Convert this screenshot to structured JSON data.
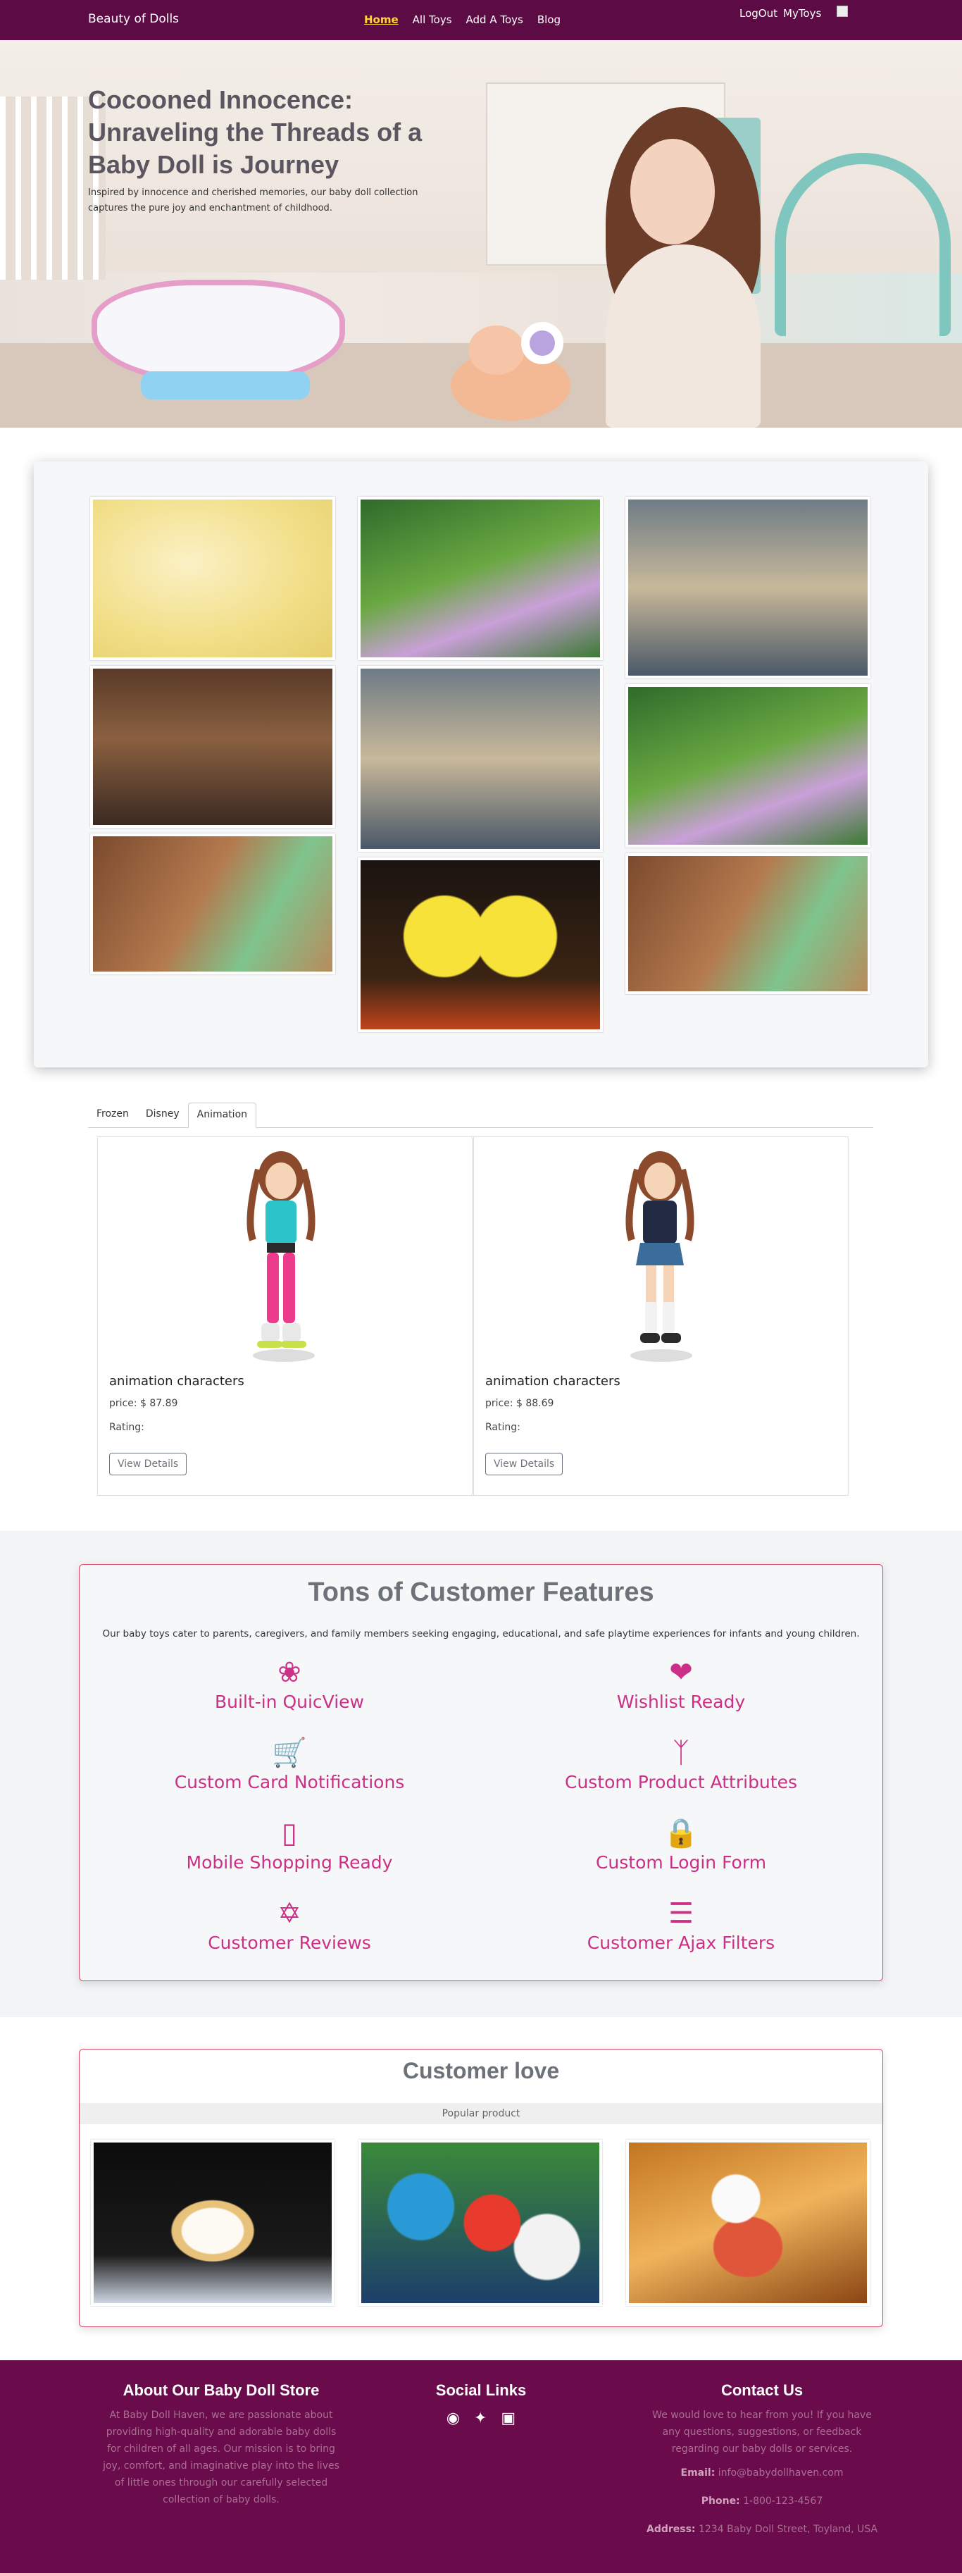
{
  "nav": {
    "brand": "Beauty of Dolls",
    "links": [
      "Home",
      "All Toys",
      "Add A Toys",
      "Blog"
    ],
    "logout": "LogOut",
    "mytoys": "MyToys"
  },
  "hero": {
    "title": "Cocooned Innocence: Unraveling the Threads of a Baby Doll is Journey",
    "subtitle": "Inspired by innocence and cherished memories, our baby doll collection captures the pure joy and enchantment of childhood."
  },
  "tabs": [
    "Frozen",
    "Disney",
    "Animation"
  ],
  "active_tab": "Animation",
  "products": [
    {
      "title": "animation characters",
      "price": "price: $ 87.89",
      "rating": "Rating:",
      "button": "View Details"
    },
    {
      "title": "animation characters",
      "price": "price: $ 88.69",
      "rating": "Rating:",
      "button": "View Details"
    }
  ],
  "features": {
    "title": "Tons of Customer Features",
    "subtitle": "Our baby toys cater to parents, caregivers, and family members seeking engaging, educational, and safe playtime experiences for infants and young children.",
    "items": [
      {
        "label": "Built-in QuicView",
        "icon": "flower-icon"
      },
      {
        "label": "Wishlist Ready",
        "icon": "heart-icon"
      },
      {
        "label": "Custom Card Notifications",
        "icon": "cart-plus-icon"
      },
      {
        "label": "Custom Product Attributes",
        "icon": "branch-icon"
      },
      {
        "label": "Mobile Shopping Ready",
        "icon": "mobile-icon"
      },
      {
        "label": "Custom Login Form",
        "icon": "user-lock-icon"
      },
      {
        "label": "Customer Reviews",
        "icon": "star-of-david-icon"
      },
      {
        "label": "Customer Ajax Filters",
        "icon": "list-icon"
      }
    ],
    "accent": "#cc2f86"
  },
  "love": {
    "title": "Customer love",
    "band": "Popular product"
  },
  "footer": {
    "about_title": "About Our Baby Doll Store",
    "about_text": "At Baby Doll Haven, we are passionate about providing high-quality and adorable baby dolls for children of all ages. Our mission is to bring joy, comfort, and imaginative play into the lives of little ones through our carefully selected collection of baby dolls.",
    "social_title": "Social Links",
    "social_icons": [
      "facebook-icon",
      "twitter-icon",
      "instagram-icon"
    ],
    "contact_title": "Contact Us",
    "contact_text": "We would love to hear from you! If you have any questions, suggestions, or feedback regarding our baby dolls or services.",
    "email_label": "Email:",
    "email": "info@babydollhaven.com",
    "phone_label": "Phone:",
    "phone": "1-800-123-4567",
    "address_label": "Address:",
    "address": "1234 Baby Doll Street, Toyland, USA"
  },
  "colors": {
    "nav_bg": "#5c0b45",
    "footer_bg": "#6a0b4c",
    "active_link": "#ffd633",
    "border_accent": "#d94a6a"
  }
}
